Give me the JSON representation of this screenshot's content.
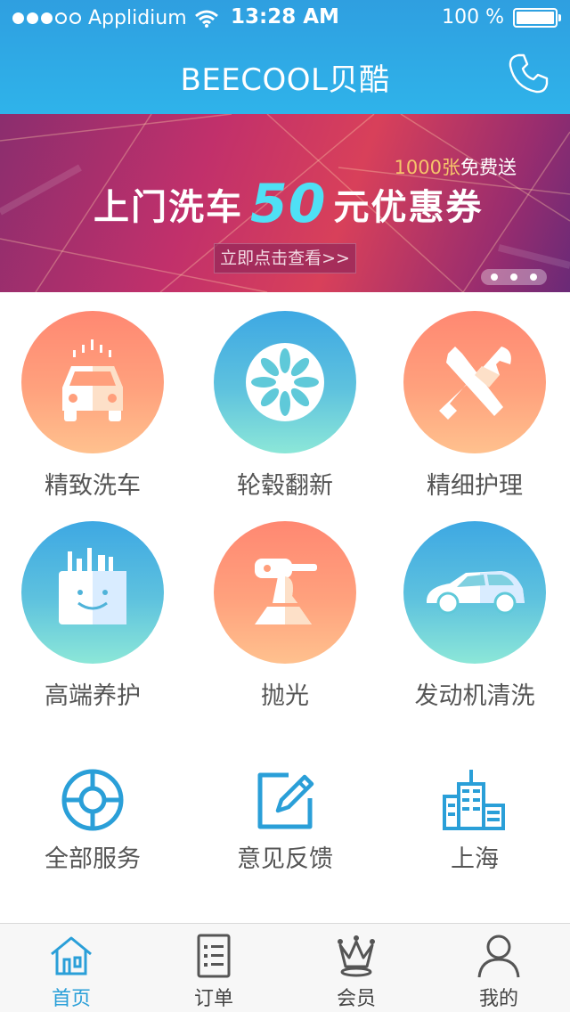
{
  "status_bar": {
    "carrier": "Applidium",
    "time": "13:28 AM",
    "battery": "100 %"
  },
  "nav": {
    "title": "BEECOOL贝酷",
    "phone_icon": "phone-icon"
  },
  "banner": {
    "count_text": "1000张",
    "free_text": "免费送",
    "title_pre": "上门洗车",
    "title_number": "50",
    "title_post": "元优惠券",
    "button_label": "立即点击查看>>",
    "page_count": 3
  },
  "services": [
    {
      "label": "精致洗车",
      "icon": "car-wash-icon",
      "style": "warm"
    },
    {
      "label": "轮毂翻新",
      "icon": "wheel-hub-icon",
      "style": "cool"
    },
    {
      "label": "精细护理",
      "icon": "tools-icon",
      "style": "warm"
    },
    {
      "label": "高端养护",
      "icon": "care-kit-icon",
      "style": "cool"
    },
    {
      "label": "抛光",
      "icon": "polisher-icon",
      "style": "warm"
    },
    {
      "label": "发动机清洗",
      "icon": "car-side-icon",
      "style": "cool"
    }
  ],
  "quick_actions": [
    {
      "label": "全部服务",
      "icon": "lifebuoy-icon"
    },
    {
      "label": "意见反馈",
      "icon": "edit-icon"
    },
    {
      "label": "上海",
      "icon": "city-icon"
    }
  ],
  "tabs": [
    {
      "label": "首页",
      "icon": "home-icon",
      "active": true
    },
    {
      "label": "订单",
      "icon": "order-list-icon",
      "active": false
    },
    {
      "label": "会员",
      "icon": "crown-icon",
      "active": false
    },
    {
      "label": "我的",
      "icon": "user-icon",
      "active": false
    }
  ],
  "colors": {
    "header": "#2fb3ea",
    "accent": "#2a9fd8",
    "warm_top": "#ff8872",
    "warm_bottom": "#ffc18e",
    "cool_top": "#3ea8e3",
    "cool_bottom": "#8ce7d8"
  }
}
